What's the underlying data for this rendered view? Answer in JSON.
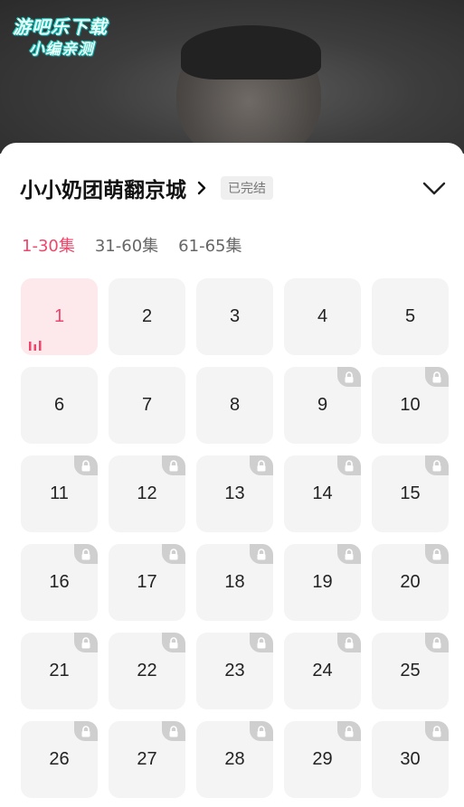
{
  "watermark": {
    "line1": "游吧乐下载",
    "line2": "小编亲测"
  },
  "drama": {
    "title": "小小奶团萌翻京城",
    "status": "已完结"
  },
  "tabs": [
    {
      "label": "1-30集",
      "active": true
    },
    {
      "label": "31-60集",
      "active": false
    },
    {
      "label": "61-65集",
      "active": false
    }
  ],
  "episodes": [
    {
      "num": "1",
      "current": true,
      "locked": false
    },
    {
      "num": "2",
      "current": false,
      "locked": false
    },
    {
      "num": "3",
      "current": false,
      "locked": false
    },
    {
      "num": "4",
      "current": false,
      "locked": false
    },
    {
      "num": "5",
      "current": false,
      "locked": false
    },
    {
      "num": "6",
      "current": false,
      "locked": false
    },
    {
      "num": "7",
      "current": false,
      "locked": false
    },
    {
      "num": "8",
      "current": false,
      "locked": false
    },
    {
      "num": "9",
      "current": false,
      "locked": true
    },
    {
      "num": "10",
      "current": false,
      "locked": true
    },
    {
      "num": "11",
      "current": false,
      "locked": true
    },
    {
      "num": "12",
      "current": false,
      "locked": true
    },
    {
      "num": "13",
      "current": false,
      "locked": true
    },
    {
      "num": "14",
      "current": false,
      "locked": true
    },
    {
      "num": "15",
      "current": false,
      "locked": true
    },
    {
      "num": "16",
      "current": false,
      "locked": true
    },
    {
      "num": "17",
      "current": false,
      "locked": true
    },
    {
      "num": "18",
      "current": false,
      "locked": true
    },
    {
      "num": "19",
      "current": false,
      "locked": true
    },
    {
      "num": "20",
      "current": false,
      "locked": true
    },
    {
      "num": "21",
      "current": false,
      "locked": true
    },
    {
      "num": "22",
      "current": false,
      "locked": true
    },
    {
      "num": "23",
      "current": false,
      "locked": true
    },
    {
      "num": "24",
      "current": false,
      "locked": true
    },
    {
      "num": "25",
      "current": false,
      "locked": true
    },
    {
      "num": "26",
      "current": false,
      "locked": true
    },
    {
      "num": "27",
      "current": false,
      "locked": true
    },
    {
      "num": "28",
      "current": false,
      "locked": true
    },
    {
      "num": "29",
      "current": false,
      "locked": true
    },
    {
      "num": "30",
      "current": false,
      "locked": true
    }
  ],
  "icons": {
    "lock": "lock-icon",
    "collapse": "chevron-down-icon",
    "detail": "chevron-right-icon",
    "playing": "playing-bars-icon"
  },
  "colors": {
    "accent": "#f0456a",
    "current_bg": "#fde8ec",
    "cell_bg": "#f4f4f4",
    "lock_bg": "#cfcfcf"
  }
}
